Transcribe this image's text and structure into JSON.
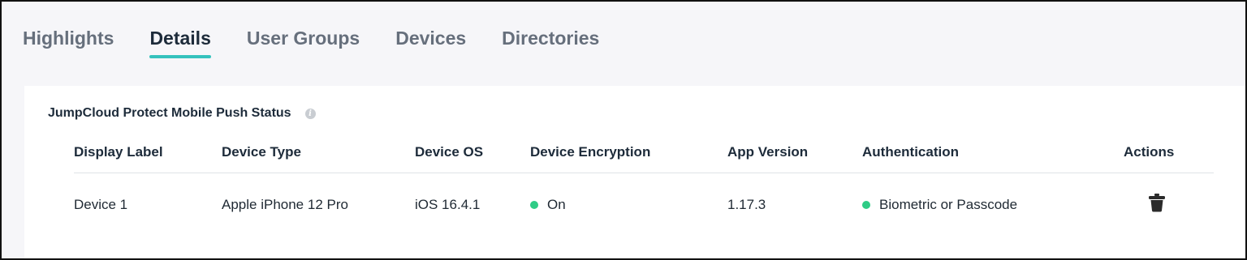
{
  "tabs": [
    {
      "label": "Highlights",
      "active": false
    },
    {
      "label": "Details",
      "active": true
    },
    {
      "label": "User Groups",
      "active": false
    },
    {
      "label": "Devices",
      "active": false
    },
    {
      "label": "Directories",
      "active": false
    }
  ],
  "colors": {
    "accent": "#35c2bd",
    "status_on": "#2fcc86",
    "page_background": "#f6f6f9"
  },
  "section": {
    "title": "JumpCloud Protect Mobile Push Status",
    "info_icon": "info-icon"
  },
  "table": {
    "headers": [
      "Display Label",
      "Device Type",
      "Device OS",
      "Device Encryption",
      "App Version",
      "Authentication",
      "Actions"
    ],
    "rows": [
      {
        "display_label": "Device 1",
        "device_type": "Apple iPhone 12 Pro",
        "device_os": "iOS 16.4.1",
        "device_encryption": "On",
        "app_version": "1.17.3",
        "authentication": "Biometric or Passcode",
        "action_icon": "trash-icon"
      }
    ]
  }
}
